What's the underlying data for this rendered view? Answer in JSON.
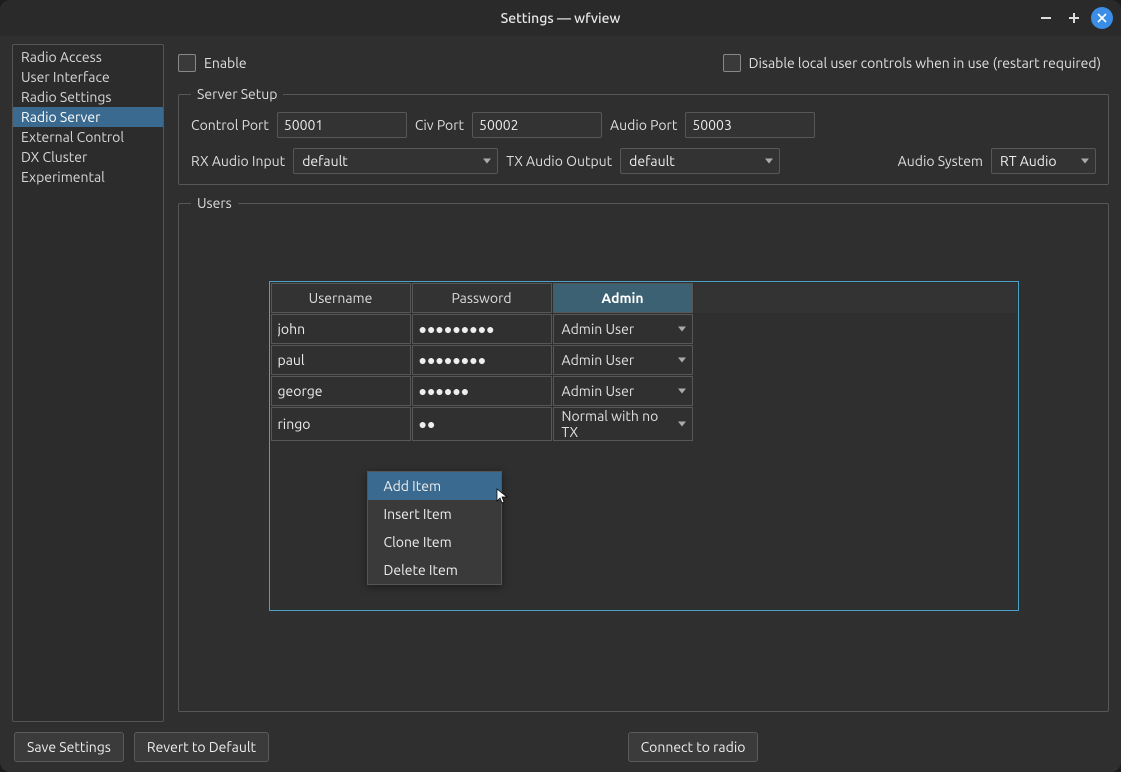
{
  "window": {
    "title": "Settings — wfview"
  },
  "sidebar": {
    "items": [
      {
        "label": "Radio Access"
      },
      {
        "label": "User Interface"
      },
      {
        "label": "Radio Settings"
      },
      {
        "label": "Radio Server",
        "selected": true
      },
      {
        "label": "External Control"
      },
      {
        "label": "DX Cluster"
      },
      {
        "label": "Experimental"
      }
    ]
  },
  "top": {
    "enable_label": "Enable",
    "disable_local_label": "Disable local user controls when in use (restart required)"
  },
  "server_setup": {
    "legend": "Server Setup",
    "control_port_label": "Control Port",
    "control_port": "50001",
    "civ_port_label": "Civ Port",
    "civ_port": "50002",
    "audio_port_label": "Audio Port",
    "audio_port": "50003",
    "rx_audio_label": "RX Audio Input",
    "rx_audio_value": "default",
    "tx_audio_label": "TX Audio Output",
    "tx_audio_value": "default",
    "audio_system_label": "Audio System",
    "audio_system_value": "RT Audio"
  },
  "users": {
    "legend": "Users",
    "headers": {
      "username": "Username",
      "password": "Password",
      "admin": "Admin"
    },
    "rows": [
      {
        "username": "john",
        "password": "●●●●●●●●●",
        "role": "Admin User"
      },
      {
        "username": "paul",
        "password": "●●●●●●●●",
        "role": "Admin User"
      },
      {
        "username": "george",
        "password": "●●●●●●",
        "role": "Admin User"
      },
      {
        "username": "ringo",
        "password": "●●",
        "role": "Normal with no TX"
      }
    ]
  },
  "context_menu": {
    "items": [
      {
        "label": "Add Item",
        "hover": true
      },
      {
        "label": "Insert Item"
      },
      {
        "label": "Clone Item"
      },
      {
        "label": "Delete Item"
      }
    ]
  },
  "footer": {
    "save": "Save Settings",
    "revert": "Revert to Default",
    "connect": "Connect to radio"
  }
}
